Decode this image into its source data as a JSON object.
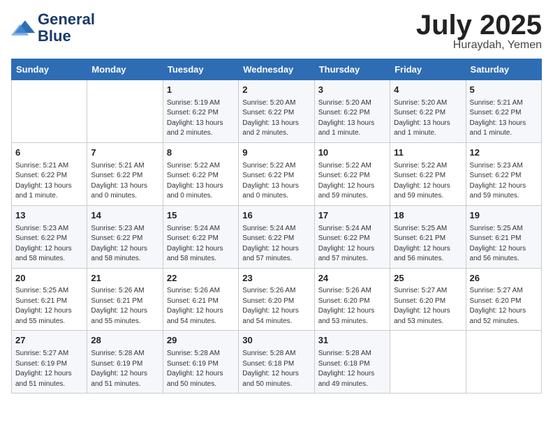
{
  "header": {
    "logo_line1": "General",
    "logo_line2": "Blue",
    "month": "July 2025",
    "location": "Huraydah, Yemen"
  },
  "weekdays": [
    "Sunday",
    "Monday",
    "Tuesday",
    "Wednesday",
    "Thursday",
    "Friday",
    "Saturday"
  ],
  "weeks": [
    [
      {
        "day": "",
        "detail": ""
      },
      {
        "day": "",
        "detail": ""
      },
      {
        "day": "1",
        "detail": "Sunrise: 5:19 AM\nSunset: 6:22 PM\nDaylight: 13 hours and 2 minutes."
      },
      {
        "day": "2",
        "detail": "Sunrise: 5:20 AM\nSunset: 6:22 PM\nDaylight: 13 hours and 2 minutes."
      },
      {
        "day": "3",
        "detail": "Sunrise: 5:20 AM\nSunset: 6:22 PM\nDaylight: 13 hours and 1 minute."
      },
      {
        "day": "4",
        "detail": "Sunrise: 5:20 AM\nSunset: 6:22 PM\nDaylight: 13 hours and 1 minute."
      },
      {
        "day": "5",
        "detail": "Sunrise: 5:21 AM\nSunset: 6:22 PM\nDaylight: 13 hours and 1 minute."
      }
    ],
    [
      {
        "day": "6",
        "detail": "Sunrise: 5:21 AM\nSunset: 6:22 PM\nDaylight: 13 hours and 1 minute."
      },
      {
        "day": "7",
        "detail": "Sunrise: 5:21 AM\nSunset: 6:22 PM\nDaylight: 13 hours and 0 minutes."
      },
      {
        "day": "8",
        "detail": "Sunrise: 5:22 AM\nSunset: 6:22 PM\nDaylight: 13 hours and 0 minutes."
      },
      {
        "day": "9",
        "detail": "Sunrise: 5:22 AM\nSunset: 6:22 PM\nDaylight: 13 hours and 0 minutes."
      },
      {
        "day": "10",
        "detail": "Sunrise: 5:22 AM\nSunset: 6:22 PM\nDaylight: 12 hours and 59 minutes."
      },
      {
        "day": "11",
        "detail": "Sunrise: 5:22 AM\nSunset: 6:22 PM\nDaylight: 12 hours and 59 minutes."
      },
      {
        "day": "12",
        "detail": "Sunrise: 5:23 AM\nSunset: 6:22 PM\nDaylight: 12 hours and 59 minutes."
      }
    ],
    [
      {
        "day": "13",
        "detail": "Sunrise: 5:23 AM\nSunset: 6:22 PM\nDaylight: 12 hours and 58 minutes."
      },
      {
        "day": "14",
        "detail": "Sunrise: 5:23 AM\nSunset: 6:22 PM\nDaylight: 12 hours and 58 minutes."
      },
      {
        "day": "15",
        "detail": "Sunrise: 5:24 AM\nSunset: 6:22 PM\nDaylight: 12 hours and 58 minutes."
      },
      {
        "day": "16",
        "detail": "Sunrise: 5:24 AM\nSunset: 6:22 PM\nDaylight: 12 hours and 57 minutes."
      },
      {
        "day": "17",
        "detail": "Sunrise: 5:24 AM\nSunset: 6:22 PM\nDaylight: 12 hours and 57 minutes."
      },
      {
        "day": "18",
        "detail": "Sunrise: 5:25 AM\nSunset: 6:21 PM\nDaylight: 12 hours and 56 minutes."
      },
      {
        "day": "19",
        "detail": "Sunrise: 5:25 AM\nSunset: 6:21 PM\nDaylight: 12 hours and 56 minutes."
      }
    ],
    [
      {
        "day": "20",
        "detail": "Sunrise: 5:25 AM\nSunset: 6:21 PM\nDaylight: 12 hours and 55 minutes."
      },
      {
        "day": "21",
        "detail": "Sunrise: 5:26 AM\nSunset: 6:21 PM\nDaylight: 12 hours and 55 minutes."
      },
      {
        "day": "22",
        "detail": "Sunrise: 5:26 AM\nSunset: 6:21 PM\nDaylight: 12 hours and 54 minutes."
      },
      {
        "day": "23",
        "detail": "Sunrise: 5:26 AM\nSunset: 6:20 PM\nDaylight: 12 hours and 54 minutes."
      },
      {
        "day": "24",
        "detail": "Sunrise: 5:26 AM\nSunset: 6:20 PM\nDaylight: 12 hours and 53 minutes."
      },
      {
        "day": "25",
        "detail": "Sunrise: 5:27 AM\nSunset: 6:20 PM\nDaylight: 12 hours and 53 minutes."
      },
      {
        "day": "26",
        "detail": "Sunrise: 5:27 AM\nSunset: 6:20 PM\nDaylight: 12 hours and 52 minutes."
      }
    ],
    [
      {
        "day": "27",
        "detail": "Sunrise: 5:27 AM\nSunset: 6:19 PM\nDaylight: 12 hours and 51 minutes."
      },
      {
        "day": "28",
        "detail": "Sunrise: 5:28 AM\nSunset: 6:19 PM\nDaylight: 12 hours and 51 minutes."
      },
      {
        "day": "29",
        "detail": "Sunrise: 5:28 AM\nSunset: 6:19 PM\nDaylight: 12 hours and 50 minutes."
      },
      {
        "day": "30",
        "detail": "Sunrise: 5:28 AM\nSunset: 6:18 PM\nDaylight: 12 hours and 50 minutes."
      },
      {
        "day": "31",
        "detail": "Sunrise: 5:28 AM\nSunset: 6:18 PM\nDaylight: 12 hours and 49 minutes."
      },
      {
        "day": "",
        "detail": ""
      },
      {
        "day": "",
        "detail": ""
      }
    ]
  ]
}
